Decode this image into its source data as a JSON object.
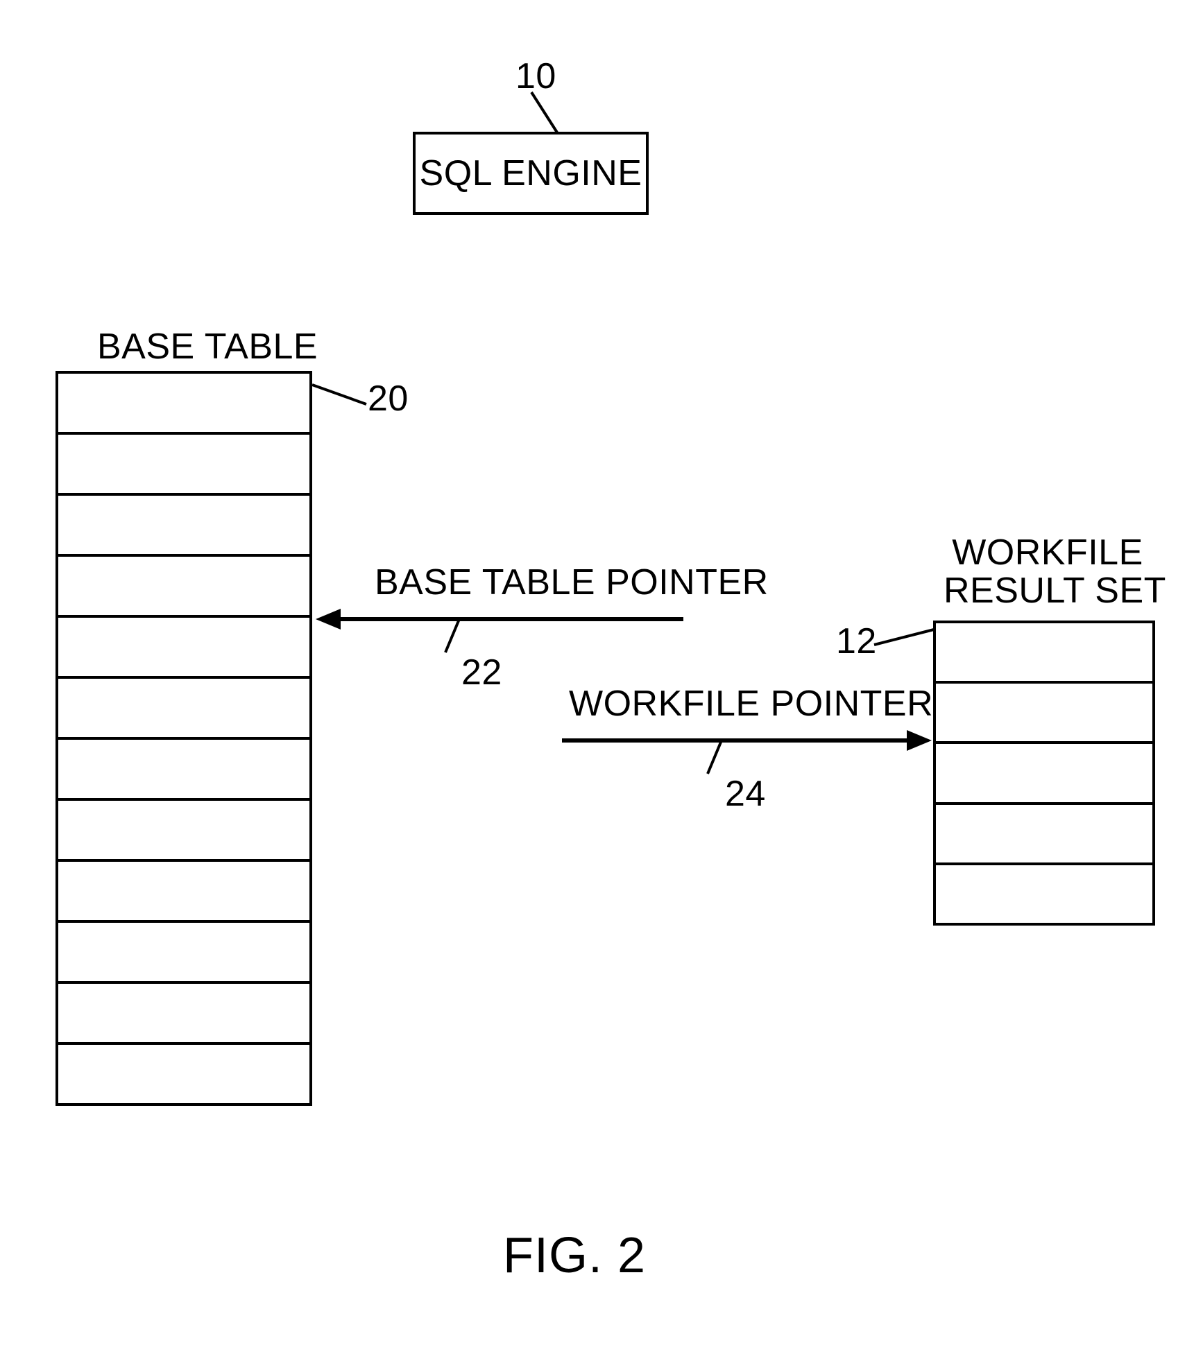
{
  "sql_engine": {
    "ref": "10",
    "label": "SQL ENGINE"
  },
  "base_table": {
    "title": "BASE TABLE",
    "ref": "20",
    "rows": 12
  },
  "base_table_pointer": {
    "label": "BASE TABLE POINTER",
    "ref": "22"
  },
  "workfile_result_set": {
    "title": "WORKFILE\nRESULT SET",
    "ref": "12",
    "rows": 5
  },
  "workfile_pointer": {
    "label": "WORKFILE POINTER",
    "ref": "24"
  },
  "figure_caption": "FIG. 2"
}
